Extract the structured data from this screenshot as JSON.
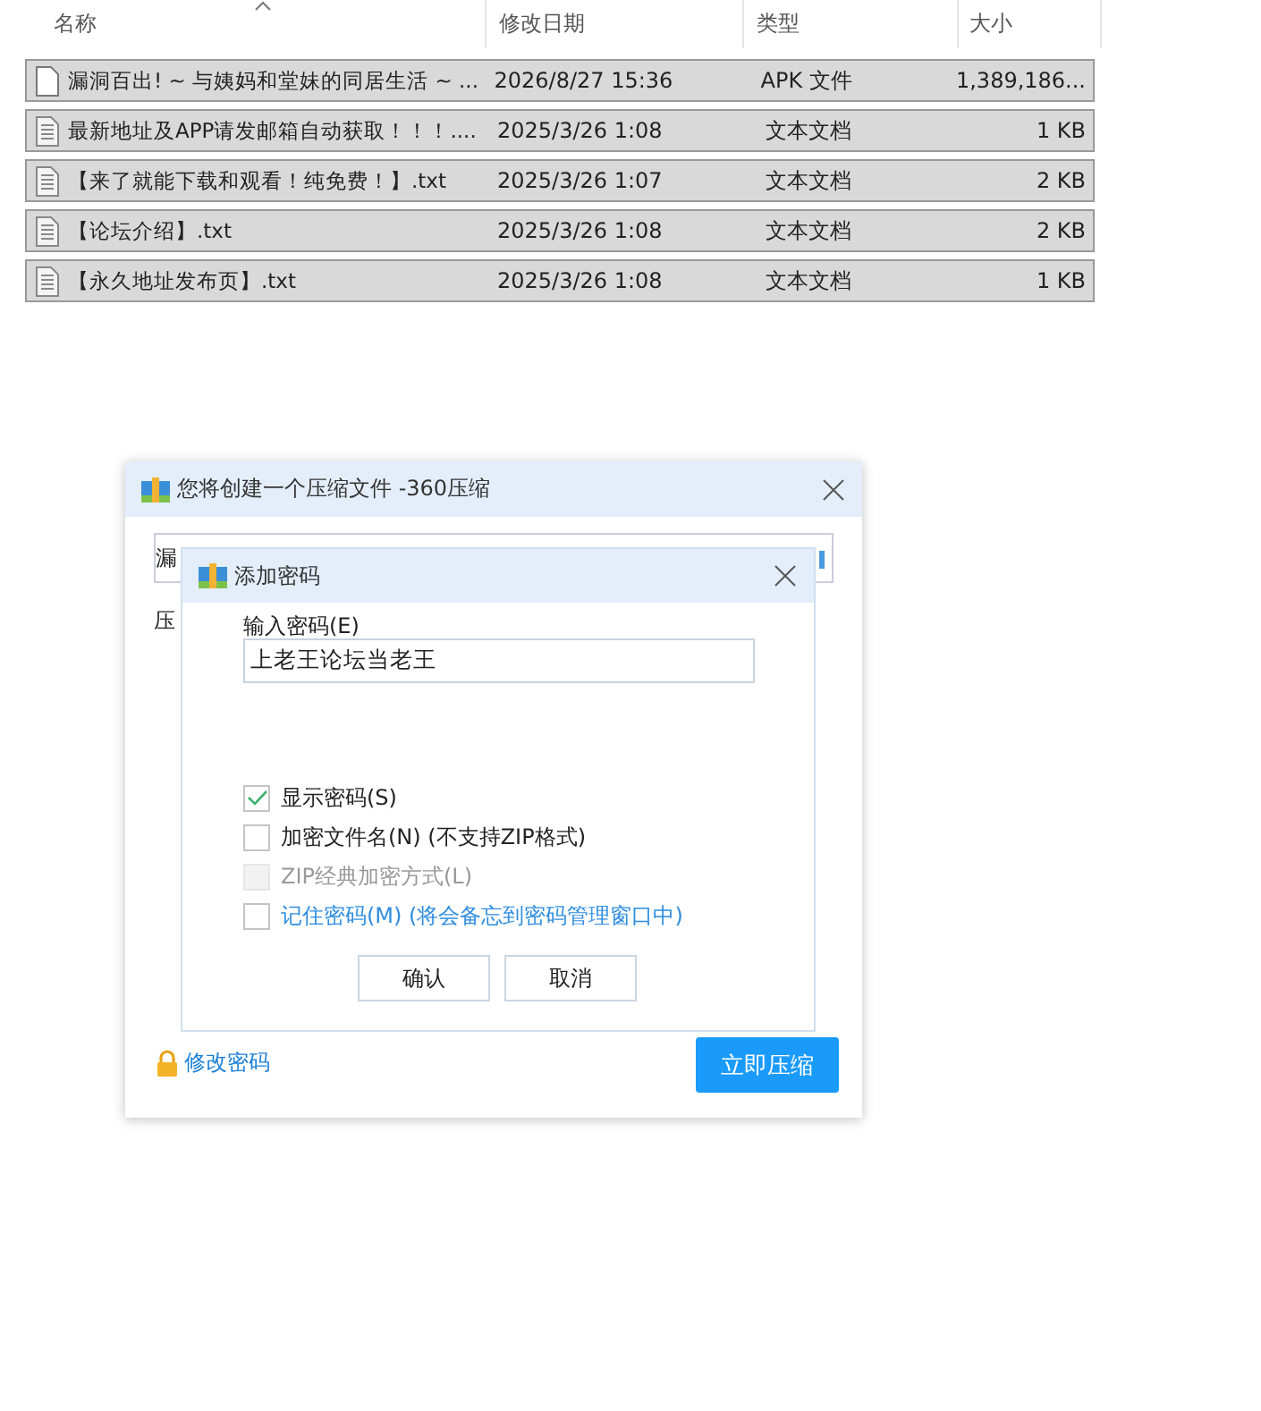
{
  "file_list": {
    "columns": [
      {
        "label": "名称",
        "sorted": true
      },
      {
        "label": "修改日期",
        "sorted": false
      },
      {
        "label": "类型",
        "sorted": false
      },
      {
        "label": "大小",
        "sorted": false
      }
    ],
    "rows": [
      {
        "kind": "apk",
        "name": "漏洞百出! ~ 与姨妈和堂妹的同居生活 ~ ...",
        "date": "2026/8/27 15:36",
        "type": "APK 文件",
        "size": "1,389,186...",
        "selected": true
      },
      {
        "kind": "txt",
        "name": "最新地址及APP请发邮箱自动获取！！！....",
        "date": "2025/3/26 1:08",
        "type": "文本文档",
        "size": "1 KB",
        "selected": true
      },
      {
        "kind": "txt",
        "name": "【来了就能下载和观看！纯免费！】.txt",
        "date": "2025/3/26 1:07",
        "type": "文本文档",
        "size": "2 KB",
        "selected": true
      },
      {
        "kind": "txt",
        "name": "【论坛介绍】.txt",
        "date": "2025/3/26 1:08",
        "type": "文本文档",
        "size": "2 KB",
        "selected": true
      },
      {
        "kind": "txt",
        "name": "【永久地址发布页】.txt",
        "date": "2025/3/26 1:08",
        "type": "文本文档",
        "size": "1 KB",
        "selected": true
      }
    ]
  },
  "compress_dialog": {
    "title": "您将创建一个压缩文件 -360压缩",
    "path_field_value": "漏",
    "label": "压",
    "change_password_link": "修改密码",
    "compress_button": "立即压缩",
    "password_dialog": {
      "title": "添加密码",
      "password_label": "输入密码(E)",
      "password_value": "上老王论坛当老王",
      "options": [
        {
          "kind": "plain",
          "label": "显示密码(S)",
          "checked": true,
          "disabled": false
        },
        {
          "kind": "plain",
          "label": "加密文件名(N) (不支持ZIP格式)",
          "checked": false,
          "disabled": false
        },
        {
          "kind": "plain",
          "label": "ZIP经典加密方式(L)",
          "checked": false,
          "disabled": true
        },
        {
          "kind": "link",
          "label": "记住密码(M) (将会备忘到密码管理窗口中)",
          "checked": false,
          "disabled": false
        }
      ],
      "buttons": [
        "确认",
        "取消"
      ]
    }
  }
}
